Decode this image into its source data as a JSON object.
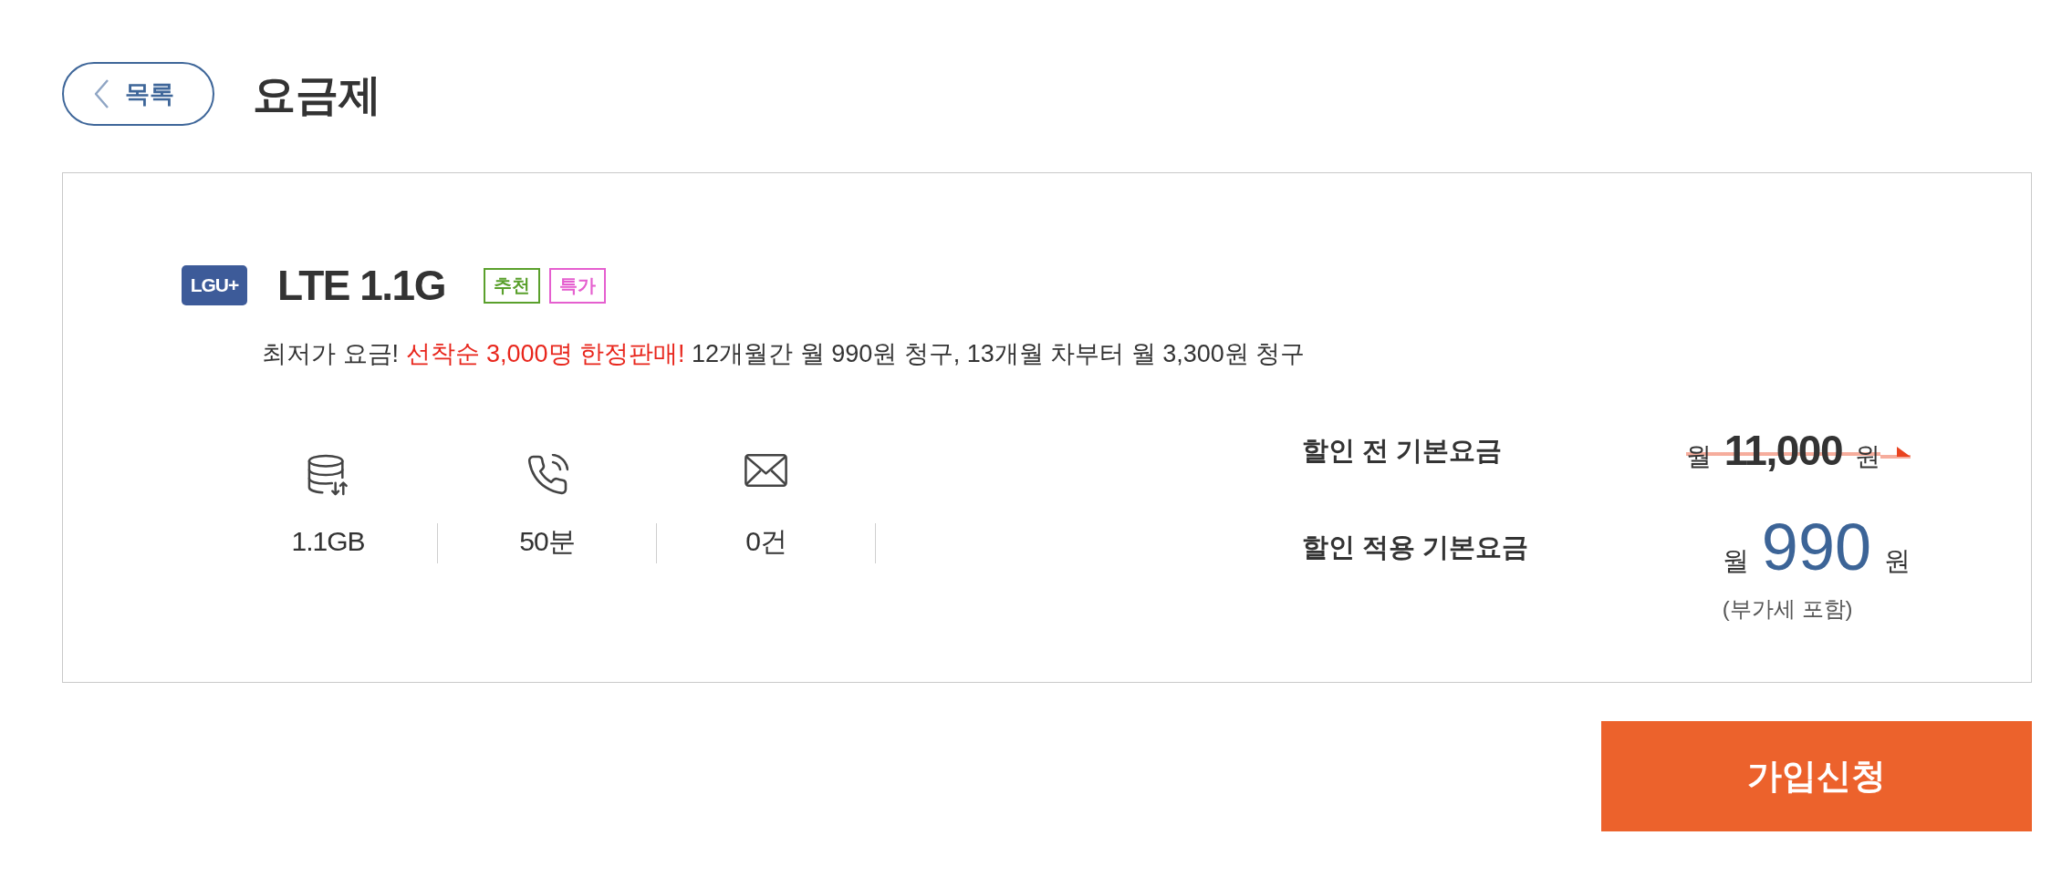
{
  "header": {
    "back_button": {
      "label": "목록"
    },
    "title": "요금제"
  },
  "plan": {
    "carrier": "LGU+",
    "name": "LTE 1.1G",
    "tags": [
      {
        "label": "추천",
        "color": "#5aa02c"
      },
      {
        "label": "특가",
        "color": "#e55fcf"
      }
    ],
    "description": [
      {
        "text": "최저가 요금! ",
        "highlight": false
      },
      {
        "text": "선착순 3,000명 한정판매!",
        "highlight": true
      },
      {
        "text": " 12개월간 월 990원 청구, 13개월 차부터 월 3,300원 청구",
        "highlight": false
      }
    ],
    "allowances": [
      {
        "kind": "data",
        "value": "1.1GB"
      },
      {
        "kind": "voice",
        "value": "50분"
      },
      {
        "kind": "sms",
        "value": "0건"
      }
    ],
    "prices": [
      {
        "kind": "before_discount",
        "label": "할인 전 기본요금",
        "prefix": "월",
        "amount": "11,000",
        "unit": "원"
      },
      {
        "kind": "after_discount",
        "label": "할인 적용 기본요금",
        "prefix": "월",
        "amount": "990",
        "unit": "원",
        "note": "(부가세 포함)"
      }
    ]
  },
  "apply_button": {
    "label": "가입신청"
  }
}
